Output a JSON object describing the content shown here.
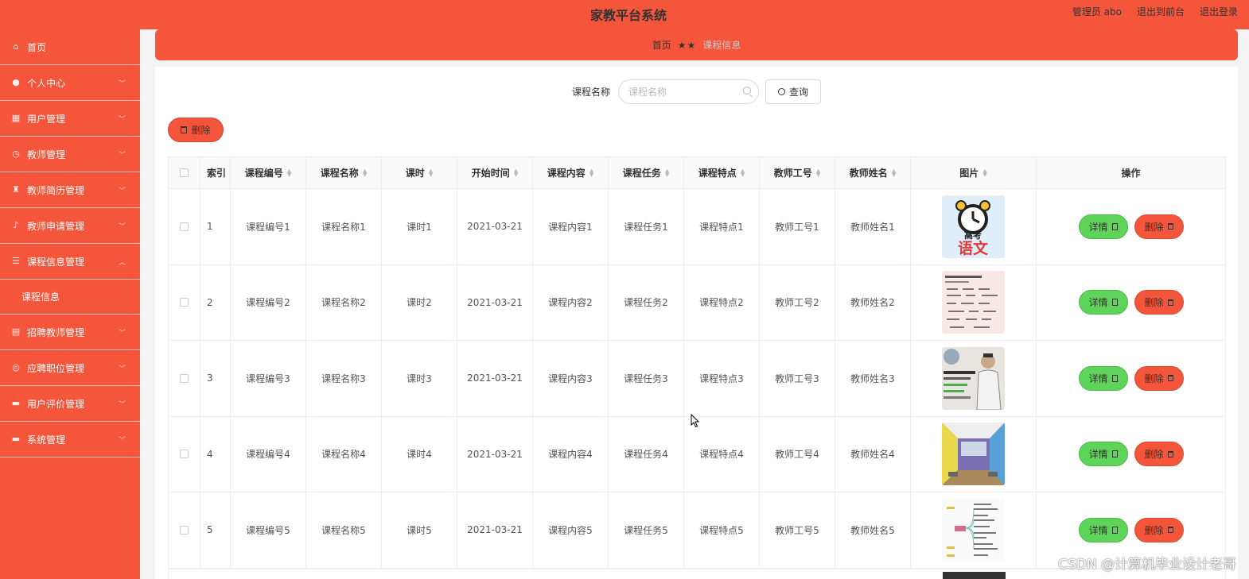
{
  "header": {
    "title": "家教平台系统",
    "user_label": "管理员 abo",
    "to_front": "退出到前台",
    "logout": "退出登录"
  },
  "sidebar": {
    "items": [
      {
        "label": "首页",
        "icon": "home-icon",
        "chevron": false
      },
      {
        "label": "个人中心",
        "icon": "user-icon",
        "chevron": true
      },
      {
        "label": "用户管理",
        "icon": "grid-icon",
        "chevron": true
      },
      {
        "label": "教师管理",
        "icon": "clock-icon",
        "chevron": true
      },
      {
        "label": "教师简历管理",
        "icon": "trophy-icon",
        "chevron": true
      },
      {
        "label": "教师申请管理",
        "icon": "mic-icon",
        "chevron": true
      },
      {
        "label": "课程信息管理",
        "icon": "list-icon",
        "chevron": true,
        "expanded": true
      }
    ],
    "sub_item": "课程信息",
    "items_after": [
      {
        "label": "招聘教师管理",
        "icon": "calendar-icon"
      },
      {
        "label": "应聘职位管理",
        "icon": "target-icon"
      },
      {
        "label": "用户评价管理",
        "icon": "monitor-icon"
      },
      {
        "label": "系统管理",
        "icon": "message-icon"
      }
    ]
  },
  "breadcrumb": {
    "home": "首页",
    "separator": "★★",
    "current": "课程信息"
  },
  "search": {
    "label": "课程名称",
    "placeholder": "课程名称",
    "button": "查询"
  },
  "toolbar": {
    "delete_label": "删除"
  },
  "table": {
    "columns": [
      "索引",
      "课程编号",
      "课程名称",
      "课时",
      "开始时间",
      "课程内容",
      "课程任务",
      "课程特点",
      "教师工号",
      "教师姓名",
      "图片",
      "操作"
    ],
    "rows": [
      {
        "index": "1",
        "code": "课程编号1",
        "name": "课程名称1",
        "hours": "课时1",
        "start": "2021-03-21",
        "content": "课程内容1",
        "task": "课程任务1",
        "feature": "课程特点1",
        "teacher_id": "教师工号1",
        "teacher_name": "教师姓名1",
        "image": "clock-chinese",
        "image_text": "高考 语文"
      },
      {
        "index": "2",
        "code": "课程编号2",
        "name": "课程名称2",
        "hours": "课时2",
        "start": "2021-03-21",
        "content": "课程内容2",
        "task": "课程任务2",
        "feature": "课程特点2",
        "teacher_id": "教师工号2",
        "teacher_name": "教师姓名2",
        "image": "document-page"
      },
      {
        "index": "3",
        "code": "课程编号3",
        "name": "课程名称3",
        "hours": "课时3",
        "start": "2021-03-21",
        "content": "课程内容3",
        "task": "课程任务3",
        "feature": "课程特点3",
        "teacher_id": "教师工号3",
        "teacher_name": "教师姓名3",
        "image": "portrait-poster"
      },
      {
        "index": "4",
        "code": "课程编号4",
        "name": "课程名称4",
        "hours": "课时4",
        "start": "2021-03-21",
        "content": "课程内容4",
        "task": "课程任务4",
        "feature": "课程特点4",
        "teacher_id": "教师工号4",
        "teacher_name": "教师姓名4",
        "image": "classroom-photo"
      },
      {
        "index": "5",
        "code": "课程编号5",
        "name": "课程名称5",
        "hours": "课时5",
        "start": "2021-03-21",
        "content": "课程内容5",
        "task": "课程任务5",
        "feature": "课程特点5",
        "teacher_id": "教师工号5",
        "teacher_name": "教师姓名5",
        "image": "mind-map"
      }
    ],
    "detail_label": "详情",
    "delete_label": "删除"
  },
  "watermark": "CSDN @计算机毕业设计老哥",
  "colors": {
    "primary": "#f5553b",
    "success": "#5fd45a",
    "background": "#f4f4f4"
  }
}
